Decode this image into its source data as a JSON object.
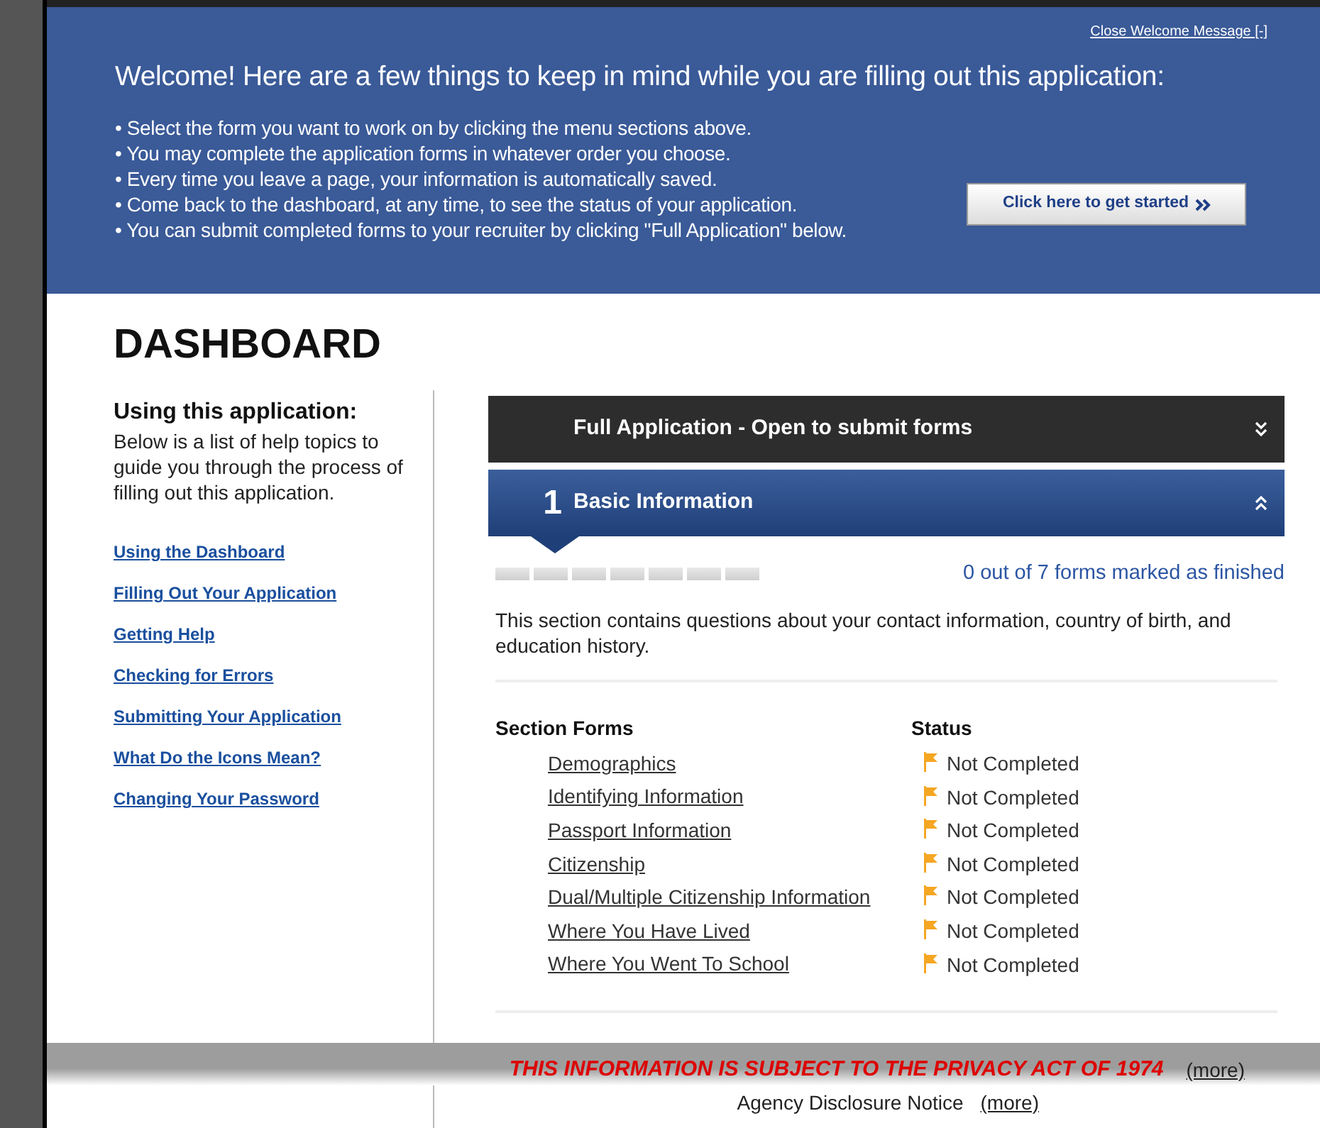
{
  "welcome": {
    "close_link": "Close Welcome Message [-]",
    "heading": "Welcome! Here are a few things to keep in mind while you are filling out this application:",
    "bullets": [
      "• Select the form you want to work on by clicking the menu sections above.",
      "• You may complete the application forms in whatever order you choose.",
      "• Every time you leave a page, your information is automatically saved.",
      "• Come back to the dashboard, at any time, to see the status of your application.",
      "• You can submit completed forms to your recruiter by clicking \"Full Application\" below."
    ],
    "button": "Click here to get started"
  },
  "page_title": "DASHBOARD",
  "sidebar": {
    "heading": "Using this application:",
    "intro": "Below is a list of help topics to guide you through the process of filling out this application.",
    "links": [
      "Using the Dashboard",
      "Filling Out Your Application",
      "Getting Help",
      "Checking for Errors",
      "Submitting Your Application",
      "What Do the Icons Mean?",
      "Changing Your Password"
    ]
  },
  "panels": [
    {
      "title": "Full Application - Open to submit forms",
      "expanded": false
    },
    {
      "number": "1",
      "title": "Basic Information",
      "expanded": true
    }
  ],
  "section": {
    "progress_text": "0 out of 7 forms marked as finished",
    "description": "This section contains questions about your contact information, country of birth, and education history.",
    "columns": [
      "Section Forms",
      "Status"
    ],
    "forms": [
      {
        "name": "Demographics",
        "status": "Not Completed",
        "completed": false
      },
      {
        "name": "Identifying Information",
        "status": "Not Completed",
        "completed": false
      },
      {
        "name": "Passport Information",
        "status": "Not Completed",
        "completed": false
      },
      {
        "name": "Citizenship",
        "status": "Not Completed",
        "completed": false
      },
      {
        "name": "Dual/Multiple Citizenship Information",
        "status": "Not Completed",
        "completed": false
      },
      {
        "name": "Where You Have Lived",
        "status": "Not Completed",
        "completed": false
      },
      {
        "name": "Where You Went To School",
        "status": "Not Completed",
        "completed": false
      }
    ]
  },
  "footer": {
    "privacy_notice": "THIS INFORMATION IS SUBJECT TO THE PRIVACY ACT OF 1974",
    "privacy_more": "(more)",
    "disclosure": "Agency Disclosure Notice",
    "disclosure_more": "(more)"
  }
}
